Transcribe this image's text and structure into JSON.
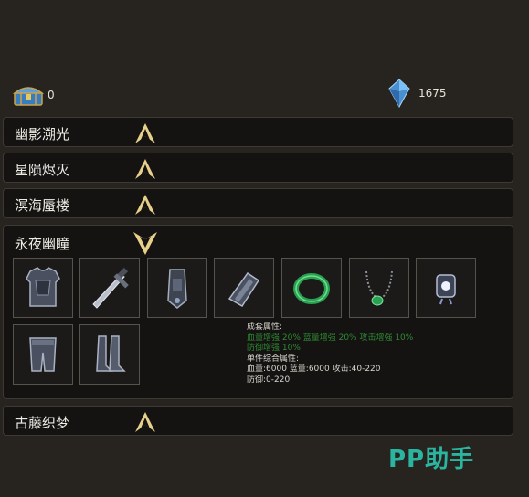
{
  "currency": {
    "chest_count": "0",
    "crystal_count": "1675"
  },
  "sets": [
    {
      "name": "幽影溯光",
      "expanded": false
    },
    {
      "name": "星陨烬灭",
      "expanded": false
    },
    {
      "name": "溟海蜃楼",
      "expanded": false
    },
    {
      "name": "永夜幽瞳",
      "expanded": true
    },
    {
      "name": "古藤织梦",
      "expanded": false
    }
  ],
  "expanded_set": {
    "name": "永夜幽瞳",
    "items": [
      "chest-armor-icon",
      "sword-icon",
      "bracer-icon",
      "gauntlet-icon",
      "jade-bracelet-icon",
      "jade-necklace-icon",
      "amulet-icon",
      "leg-armor-icon",
      "boots-icon"
    ],
    "set_attr_label": "成套属性:",
    "set_bonus_line1": "血量增强 20%  蓝量增强 20%  攻击增强 10%",
    "set_bonus_line2": "防御增强 10%",
    "single_attr_label": "单件综合属性:",
    "stat_line1": "血量:6000    蓝量:6000    攻击:40-220",
    "stat_line2": "防御:0-220"
  },
  "watermark": "PP助手",
  "colors": {
    "background": "#27231f",
    "row_bg": "#141312",
    "gold_chevron": "#e8d08a",
    "bonus_green": "#2f8a33",
    "watermark": "#2ab5a0"
  }
}
